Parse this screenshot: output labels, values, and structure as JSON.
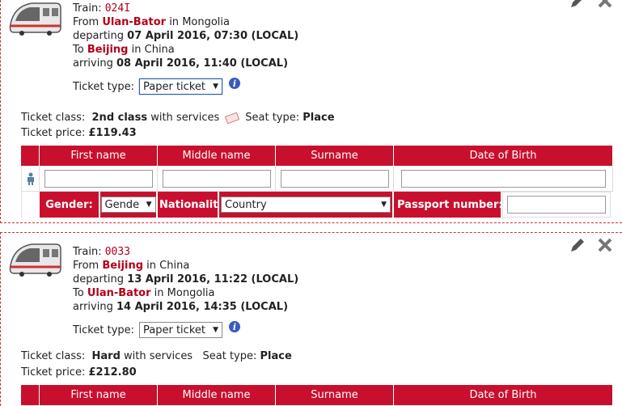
{
  "labels": {
    "train_prefix": "Train:",
    "from_prefix": "From",
    "in_word": "in",
    "departing_prefix": "departing",
    "to_prefix": "To",
    "arriving_prefix": "arriving",
    "ticket_type": "Ticket type:",
    "ticket_class": "Ticket class:",
    "with_services": "with services",
    "seat_type": "Seat type:",
    "ticket_price": "Ticket price:",
    "first_name": "First name",
    "middle_name": "Middle name",
    "surname": "Surname",
    "dob": "Date of Birth",
    "gender": "Gender:",
    "nationality": "Nationality",
    "passport": "Passport number:",
    "info_icon": "i"
  },
  "tickets": [
    {
      "train": "024I",
      "from_city": "Ulan-Bator",
      "from_country": "Mongolia",
      "departing": "07 April 2016, 07:30 (LOCAL)",
      "to_city": "Beijing",
      "to_country": "China",
      "arriving": "08 April 2016, 11:40 (LOCAL)",
      "ticket_type": "Paper ticket",
      "ticket_class": "2nd class",
      "seat_type": "Place",
      "price": "£119.43",
      "gender_placeholder": "Gende",
      "country_placeholder": "Country"
    },
    {
      "train": "0033",
      "from_city": "Beijing",
      "from_country": "China",
      "departing": "13 April 2016, 11:22 (LOCAL)",
      "to_city": "Ulan-Bator",
      "to_country": "Mongolia",
      "arriving": "14 April 2016, 14:35 (LOCAL)",
      "ticket_type": "Paper ticket",
      "ticket_class": "Hard",
      "seat_type": "Place",
      "price": "£212.80"
    }
  ],
  "colors": {
    "accent": "#c8102e",
    "link_red": "#b3001b",
    "info_blue": "#3a5bbf"
  },
  "icons": [
    "train-icon",
    "edit-pencil-icon",
    "delete-x-icon",
    "info-icon",
    "ticket-icon",
    "passenger-icon"
  ]
}
